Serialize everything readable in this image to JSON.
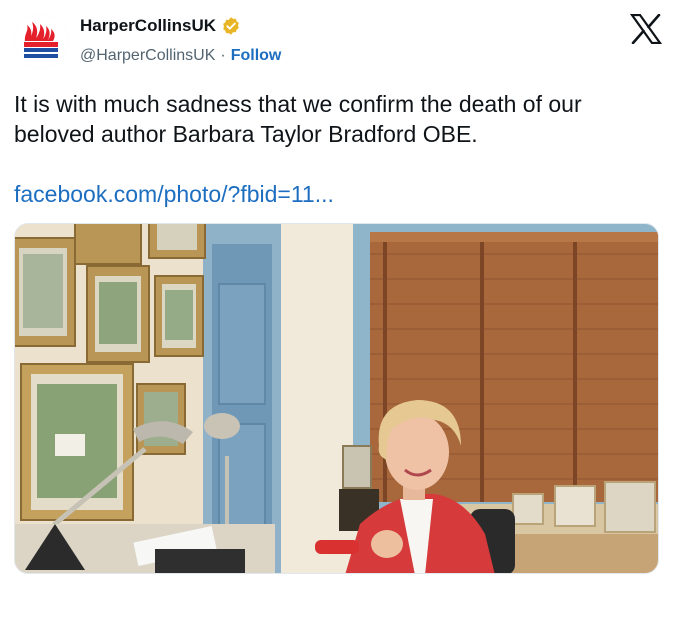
{
  "author": {
    "display_name": "HarperCollinsUK",
    "handle": "@HarperCollinsUK",
    "separator": "·",
    "follow_label": "Follow",
    "verified_color": "#e8b526"
  },
  "tweet": {
    "text": "It is with much sadness that we confirm the death of our beloved author Barbara Taylor Bradford OBE.",
    "link_text": "facebook.com/photo/?fbid=11..."
  },
  "colors": {
    "link": "#1d6ec0",
    "brand_red": "#e4202b",
    "brand_blue": "#1e4fa3"
  },
  "icons": {
    "logo": "harpercollins-logo",
    "verified": "verified-badge-icon",
    "platform": "x-logo-icon"
  }
}
